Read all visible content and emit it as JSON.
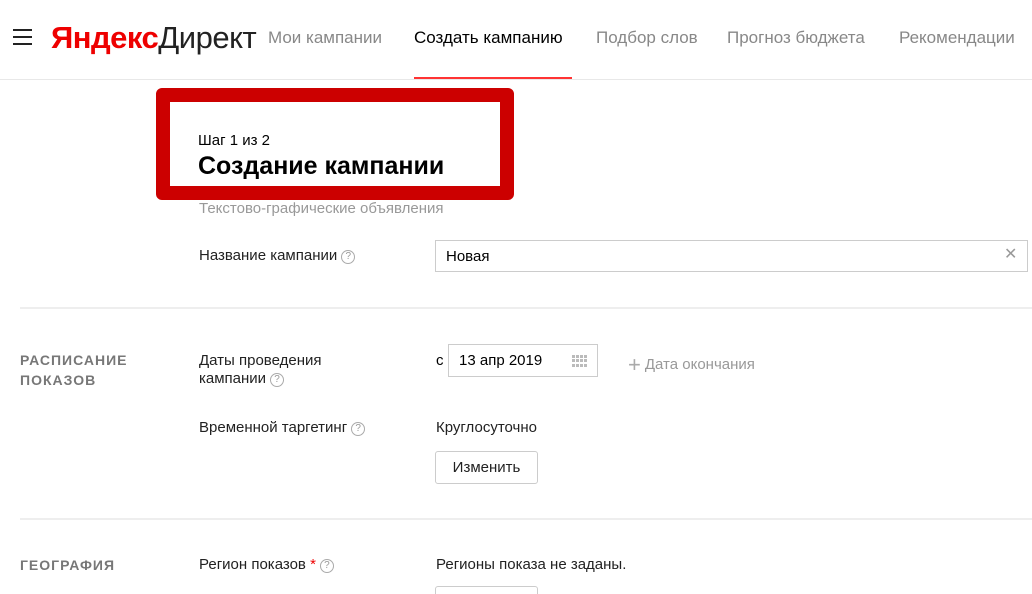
{
  "header": {
    "logo_yandex": "Яндекс",
    "logo_direct": "Директ",
    "nav": [
      "Мои кампании",
      "Создать кампанию",
      "Подбор слов",
      "Прогноз бюджета",
      "Рекомендации"
    ]
  },
  "title": {
    "step": "Шаг 1 из 2",
    "heading": "Создание кампании",
    "subtitle": "Текстово-графические объявления"
  },
  "campaign_name": {
    "label": "Название кампании",
    "value": "Новая"
  },
  "schedule": {
    "section_title_line1": "РАСПИСАНИЕ",
    "section_title_line2": "ПОКАЗОВ",
    "dates_label_line1": "Даты проведения",
    "dates_label_line2": "кампании",
    "from_label": "с",
    "start_date": "13 апр 2019",
    "add_end_date": "Дата окончания",
    "time_targeting_label": "Временной таргетинг",
    "time_targeting_value": "Круглосуточно",
    "change_button": "Изменить"
  },
  "geography": {
    "section_title": "ГЕОГРАФИЯ",
    "region_label": "Регион показов",
    "required_mark": "*",
    "region_value": "Регионы показа не заданы."
  },
  "colors": {
    "accent": "#ff3333",
    "highlight_box": "#cc0000",
    "logo_red": "#ee0000"
  }
}
